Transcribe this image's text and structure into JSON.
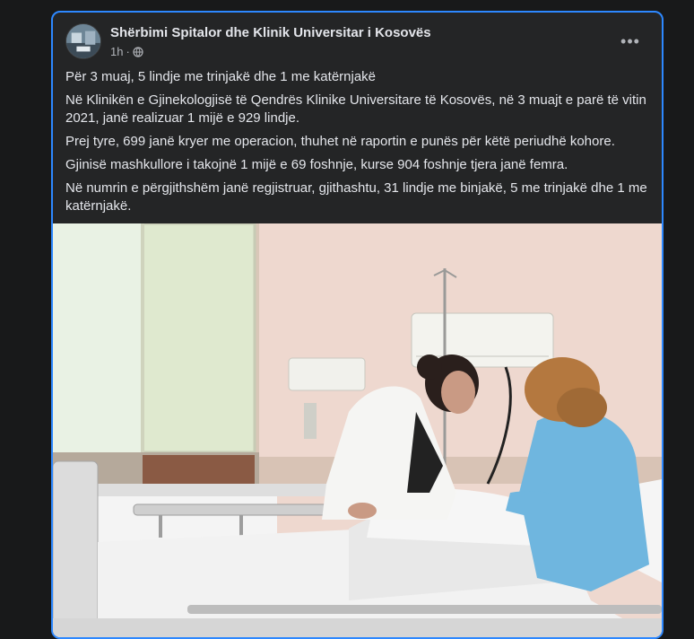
{
  "post": {
    "page_name": "Shërbimi Spitalor dhe Klinik Universitar i Kosovës",
    "time": "1h",
    "time_separator": "·",
    "privacy_icon": "globe-icon",
    "more_icon": "more-options-icon",
    "more_label": "•••",
    "paragraphs": [
      "Për 3 muaj, 5 lindje me trinjakë dhe 1 me katërnjakë",
      "Në Klinikën e Gjinekologjisë të Qendrës Klinike Universitare të Kosovës, në 3 muajt e parë të vitin 2021, janë realizuar 1 mijë e 929 lindje.",
      "Prej tyre, 699 janë kryer me operacion, thuhet në raportin e punës për këtë periudhë kohore.",
      "Gjinisë mashkullore i takojnë 1 mijë e 69 foshnje, kurse 904 foshnje tjera janë femra.",
      "Në numrin e përgjithshëm janë regjistruar, gjithashtu, 31 lindje me binjakë, 5 me trinjakë dhe 1 me katërnjakë."
    ]
  },
  "colors": {
    "page_bg": "#18191a",
    "card_bg": "#242526",
    "focus_border": "#2d88ff",
    "primary_text": "#e4e6eb",
    "secondary_text": "#b0b3b8"
  }
}
